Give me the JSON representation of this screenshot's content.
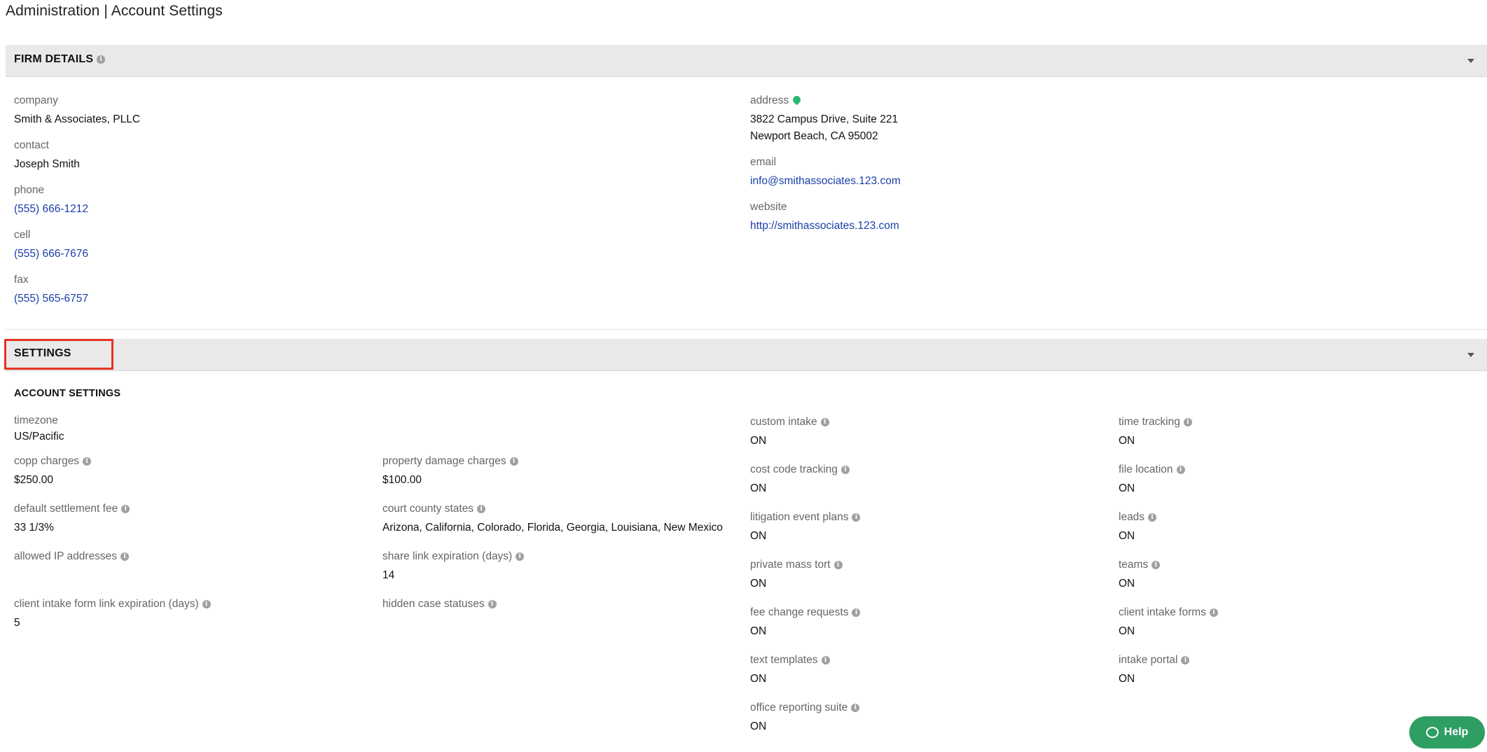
{
  "page": {
    "title": "Administration | Account Settings"
  },
  "firm_details": {
    "header": "FIRM DETAILS",
    "icons": {
      "info": "info-icon",
      "collapse": "chevron-down-icon",
      "address_pin": "map-pin-icon"
    },
    "left": [
      {
        "label": "company",
        "value": "Smith & Associates, PLLC",
        "link": false
      },
      {
        "label": "contact",
        "value": "Joseph Smith",
        "link": false
      },
      {
        "label": "phone",
        "value": "(555) 666-1212",
        "link": true
      },
      {
        "label": "cell",
        "value": "(555) 666-7676",
        "link": true
      },
      {
        "label": "fax",
        "value": "(555) 565-6757",
        "link": true
      }
    ],
    "address": {
      "label": "address",
      "line1": "3822 Campus Drive, Suite 221",
      "line2": "Newport Beach, CA 95002"
    },
    "email": {
      "label": "email",
      "value": "info@smithassociates.123.com"
    },
    "website": {
      "label": "website",
      "value": "http://smithassociates.123.com"
    }
  },
  "settings": {
    "header": "SETTINGS",
    "subheader": "ACCOUNT SETTINGS",
    "col1": [
      {
        "label": "timezone",
        "value": "US/Pacific"
      },
      {
        "label": "copp charges",
        "value": "$250.00"
      },
      {
        "label": "default settlement fee",
        "value": "33 1/3%"
      },
      {
        "label": "allowed IP addresses",
        "value": ""
      },
      {
        "label": "client intake form link expiration (days)",
        "value": "5"
      }
    ],
    "col2": [
      {
        "label": "property damage charges",
        "value": "$100.00"
      },
      {
        "label": "court county states",
        "value": "Arizona, California, Colorado, Florida, Georgia, Louisiana, New Mexico"
      },
      {
        "label": "share link expiration (days)",
        "value": "14"
      },
      {
        "label": "hidden case statuses",
        "value": ""
      }
    ],
    "col3": [
      {
        "label": "custom intake",
        "value": "ON"
      },
      {
        "label": "cost code tracking",
        "value": "ON"
      },
      {
        "label": "litigation event plans",
        "value": "ON"
      },
      {
        "label": "private mass tort",
        "value": "ON"
      },
      {
        "label": "fee change requests",
        "value": "ON"
      },
      {
        "label": "text templates",
        "value": "ON"
      },
      {
        "label": "office reporting suite",
        "value": "ON"
      }
    ],
    "col4": [
      {
        "label": "time tracking",
        "value": "ON"
      },
      {
        "label": "file location",
        "value": "ON"
      },
      {
        "label": "leads",
        "value": "ON"
      },
      {
        "label": "teams",
        "value": "ON"
      },
      {
        "label": "client intake forms",
        "value": "ON"
      },
      {
        "label": "intake portal",
        "value": "ON"
      }
    ]
  },
  "help": {
    "label": "Help",
    "icon": "chat-bubble-icon",
    "color": "#2f9e63"
  },
  "colors": {
    "link": "#1a3fa8",
    "header_bg": "#e9e9e9",
    "highlight": "#e53323",
    "pin": "#2bb673"
  }
}
